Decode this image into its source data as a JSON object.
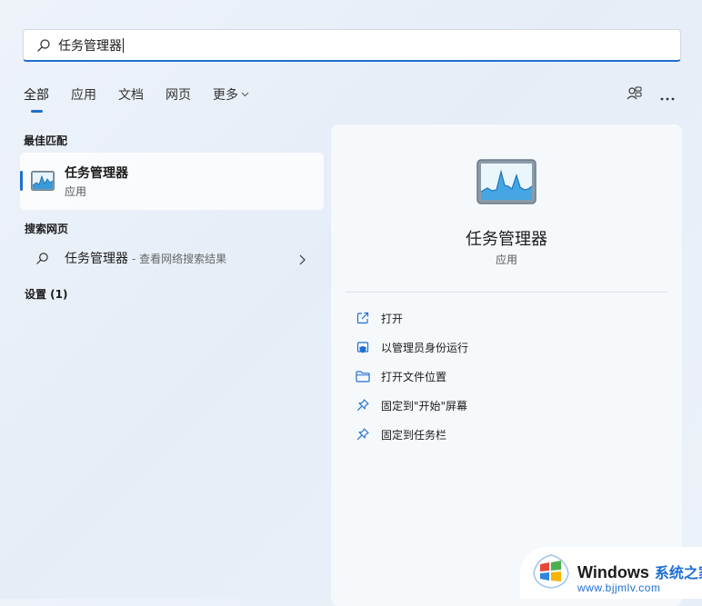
{
  "search": {
    "query": "任务管理器"
  },
  "tabs": [
    {
      "label": "全部"
    },
    {
      "label": "应用"
    },
    {
      "label": "文档"
    },
    {
      "label": "网页"
    },
    {
      "label": "更多"
    }
  ],
  "sections": {
    "best_match": "最佳匹配",
    "web_search": "搜索网页",
    "settings": "设置 (1)"
  },
  "best_match": {
    "name": "任务管理器",
    "type": "应用",
    "icon": "task-manager-icon"
  },
  "web_result": {
    "query": "任务管理器",
    "hint": "- 查看网络搜索结果"
  },
  "preview": {
    "name": "任务管理器",
    "type": "应用",
    "actions": [
      {
        "label": "打开",
        "icon": "open-icon"
      },
      {
        "label": "以管理员身份运行",
        "icon": "admin-shield-icon"
      },
      {
        "label": "打开文件位置",
        "icon": "folder-icon"
      },
      {
        "label": "固定到\"开始\"屏幕",
        "icon": "pin-icon"
      },
      {
        "label": "固定到任务栏",
        "icon": "pin-icon"
      }
    ]
  },
  "watermark": {
    "title": "Windows",
    "title_cn": "系统之家",
    "url": "www.bjjmlv.com"
  },
  "colors": {
    "accent": "#1f6fd1"
  }
}
